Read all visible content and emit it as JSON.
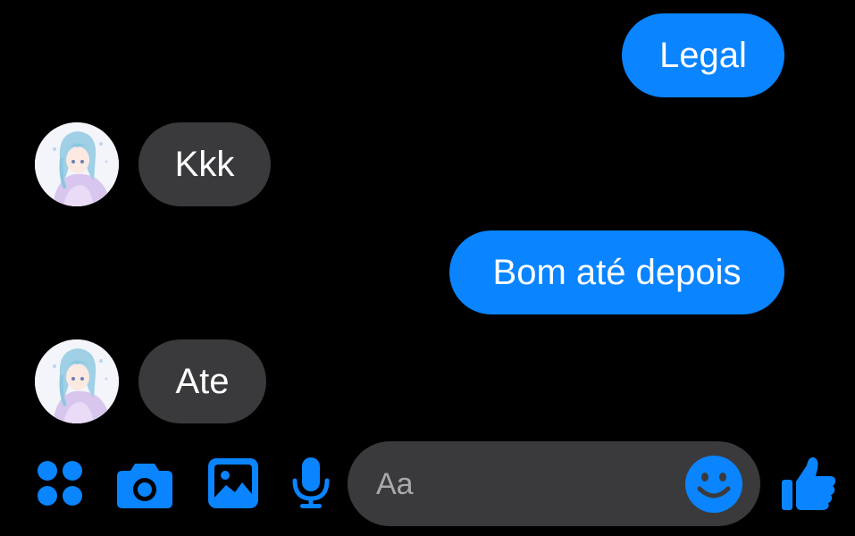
{
  "messages": [
    {
      "direction": "outgoing",
      "text": "Legal"
    },
    {
      "direction": "incoming",
      "text": "Kkk"
    },
    {
      "direction": "outgoing",
      "text": "Bom até depois"
    },
    {
      "direction": "incoming",
      "text": "Ate"
    }
  ],
  "composer": {
    "placeholder": "Aa",
    "icons": [
      "apps-icon",
      "camera-icon",
      "gallery-icon",
      "microphone-icon",
      "emoji-icon",
      "thumbs-up-icon"
    ]
  },
  "colors": {
    "background": "#000000",
    "outgoing_bubble": "#0a84ff",
    "incoming_bubble": "#3a3a3c",
    "accent": "#0a84ff",
    "text": "#ffffff",
    "placeholder": "#a8a8ad"
  }
}
